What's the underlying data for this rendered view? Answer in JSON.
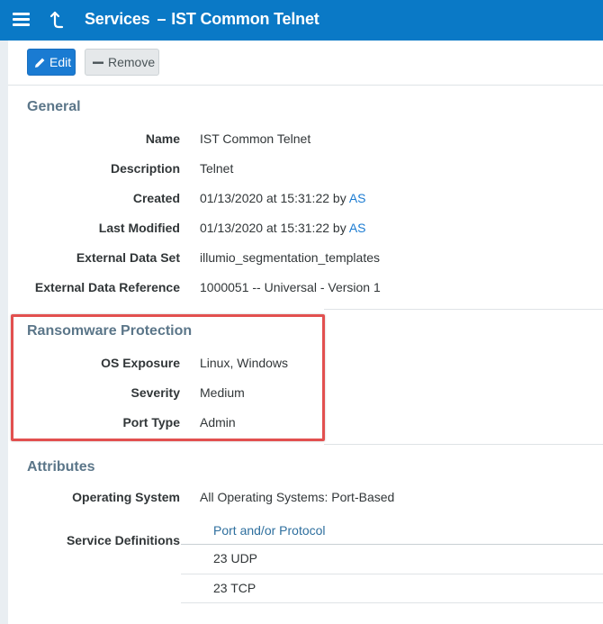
{
  "header": {
    "title": "Services",
    "separator": "–",
    "subtitle": "IST Common Telnet"
  },
  "toolbar": {
    "edit_label": "Edit",
    "remove_label": "Remove"
  },
  "general": {
    "title": "General",
    "rows": [
      {
        "label": "Name",
        "value": "IST Common Telnet"
      },
      {
        "label": "Description",
        "value": "Telnet"
      },
      {
        "label": "Created",
        "value": "01/13/2020 at 15:31:22 by ",
        "user": "AS"
      },
      {
        "label": "Last Modified",
        "value": "01/13/2020 at 15:31:22 by ",
        "user": "AS"
      },
      {
        "label": "External Data Set",
        "value": "illumio_segmentation_templates"
      },
      {
        "label": "External Data Reference",
        "value": "1000051 -- Universal - Version 1"
      }
    ]
  },
  "ransomware": {
    "title": "Ransomware Protection",
    "rows": [
      {
        "label": "OS Exposure",
        "value": "Linux, Windows"
      },
      {
        "label": "Severity",
        "value": "Medium"
      },
      {
        "label": "Port Type",
        "value": "Admin"
      }
    ]
  },
  "attributes": {
    "title": "Attributes",
    "operating_system": {
      "label": "Operating System",
      "value": "All Operating Systems: Port-Based"
    },
    "service_definitions": {
      "label": "Service Definitions",
      "column_header": "Port and/or Protocol",
      "rows": [
        "23 UDP",
        "23 TCP"
      ]
    }
  },
  "colors": {
    "header_bg": "#0a79c6",
    "accent": "#1a7bd2",
    "section_title": "#5b7689",
    "highlight_border": "#e2504f"
  }
}
